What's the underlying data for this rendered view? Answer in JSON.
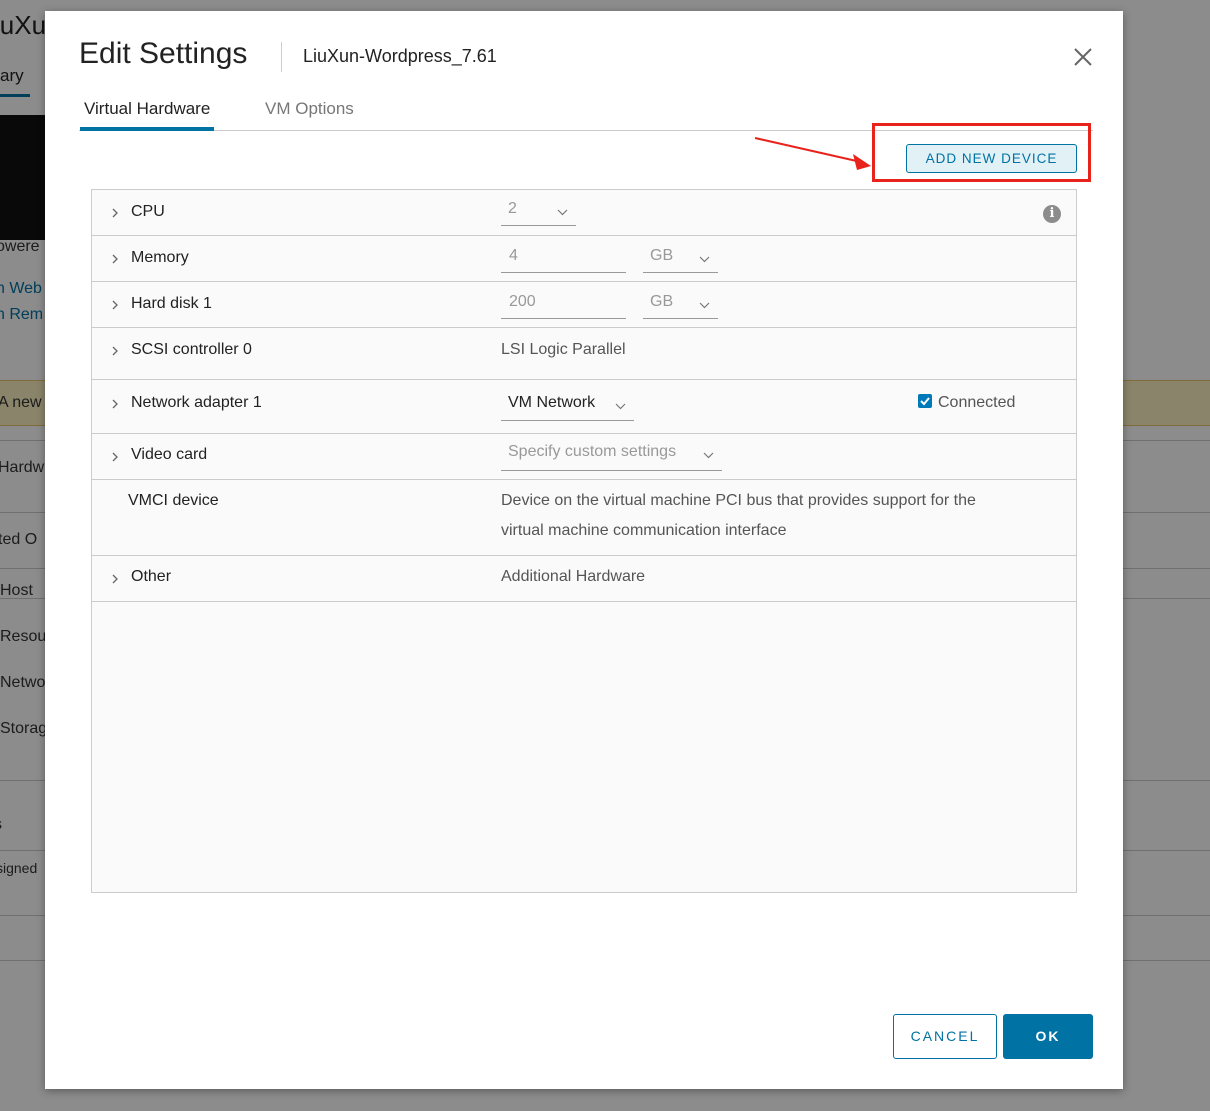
{
  "background": {
    "title": "iuXu",
    "tab": "ary",
    "texts": [
      "owere",
      "n Web",
      "n Rem",
      "A new",
      "Hardw",
      "ted O",
      "Host",
      "Resou",
      "Netwo",
      "Storag",
      "s",
      "signed"
    ]
  },
  "dialog": {
    "title": "Edit Settings",
    "subtitle": "LiuXun-Wordpress_7.61",
    "tabs": [
      {
        "label": "Virtual Hardware",
        "active": true
      },
      {
        "label": "VM Options",
        "active": false
      }
    ],
    "add_device_label": "ADD NEW DEVICE",
    "rows": {
      "cpu": {
        "label": "CPU",
        "value": "2"
      },
      "memory": {
        "label": "Memory",
        "value": "4",
        "unit": "GB"
      },
      "hard_disk": {
        "label": "Hard disk 1",
        "value": "200",
        "unit": "GB"
      },
      "scsi": {
        "label": "SCSI controller 0",
        "value": "LSI Logic Parallel"
      },
      "network": {
        "label": "Network adapter 1",
        "value": "VM Network",
        "connected_label": "Connected",
        "connected": true
      },
      "video": {
        "label": "Video card",
        "value": "Specify custom settings"
      },
      "vmci": {
        "label": "VMCI device",
        "desc_line1": "Device on the virtual machine PCI bus that provides support for the",
        "desc_line2": "virtual machine communication interface"
      },
      "other": {
        "label": "Other",
        "value": "Additional Hardware"
      }
    },
    "cancel_label": "CANCEL",
    "ok_label": "OK"
  },
  "colors": {
    "accent": "#0072a3",
    "highlight": "#e8231c",
    "checkbox": "#0079b8"
  }
}
